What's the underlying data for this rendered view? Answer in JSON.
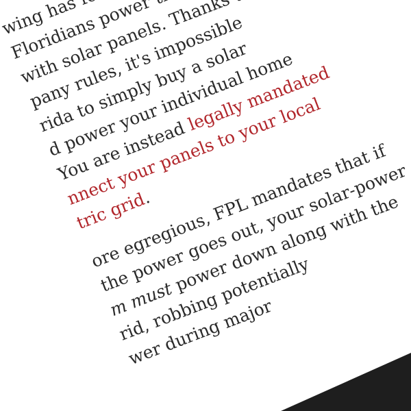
{
  "article": {
    "paragraph1": {
      "l1": "wing has fought hard",
      "l2": "Floridians power their",
      "l3": "with solar panels. Thanks to",
      "l4": "pany rules, it's impossible",
      "l5": "rida to simply buy a solar",
      "l6": "d power your individual home",
      "l7_text": "You are instead ",
      "l7_link": "legally mandated",
      "l8_link": "nnect your panels to your local",
      "l9_link": "tric grid",
      "l9_text": "."
    },
    "paragraph2": {
      "l1": "ore egregious, FPL mandates that if",
      "l2": "the power goes out, your solar-power",
      "l3_em": "m must",
      "l3_text": " power down along with the",
      "l4": "rid, robbing potentially",
      "l5": "wer during major"
    }
  },
  "colors": {
    "text": "#2a2a2a",
    "link": "#b1262b",
    "corner": "#1e1e1e"
  }
}
